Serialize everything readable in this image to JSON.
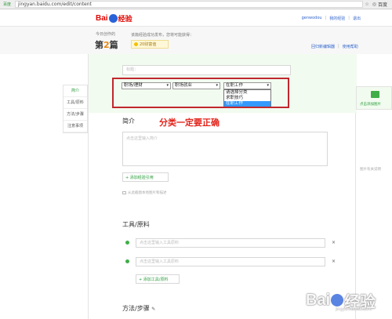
{
  "browser": {
    "home_label": "百度",
    "url": "jingyan.baidu.com/edit/content",
    "ext_icons": [
      "☆",
      "◎"
    ],
    "ext_label": "百度"
  },
  "topbar": {
    "logo_bai": "Bai",
    "logo_jy": "经验",
    "username": "genwodou",
    "my_jingyan": "我的经验",
    "logout": "退出",
    "sep": "|"
  },
  "header": {
    "today_label": "今日创作的",
    "count_prefix": "第",
    "count_num": "2",
    "count_suffix": "篇",
    "message": "该篇经验成功发布，您将可能获得：",
    "wealth": "20财富值",
    "link_new_editor": "回归新编辑器",
    "link_help": "使用帮助",
    "sep": "|"
  },
  "form": {
    "title_placeholder": "标题：",
    "category1": "职场/理财",
    "category2": "职场就业",
    "category3": "在职工作",
    "category_options": [
      "请选择分类",
      "求职技巧",
      "在职工作"
    ],
    "annotation": "分类一定要正确",
    "intro_label": "简介",
    "intro_placeholder": "点击这里输入简介",
    "add_reference": "+ 添加经验引用",
    "hint": "从此截图本地图片和描述",
    "tools_label": "工具/原料",
    "tool_placeholder_1": "点击这里输入工具原料",
    "tool_placeholder_2": "点击这里输入工具原料",
    "remove": "×",
    "add_tool": "+ 添加工具/原料",
    "steps_label": "方法/步骤",
    "steps_pencil": "✎"
  },
  "leftnav": {
    "items": [
      "简介",
      "工具/原料",
      "方法/步骤",
      "注意事项"
    ]
  },
  "rightside": {
    "upload_label": "点击添加图片",
    "side_hint": "图片有关说明"
  },
  "watermark": {
    "text_a": "Bai",
    "text_b": "经验",
    "url": "jingyan.baidu.com"
  },
  "colors": {
    "brand_red": "#e10602",
    "accent_green": "#2a9d3a",
    "highlight_blue": "#3399ff",
    "annotation_red": "#c1272d"
  }
}
